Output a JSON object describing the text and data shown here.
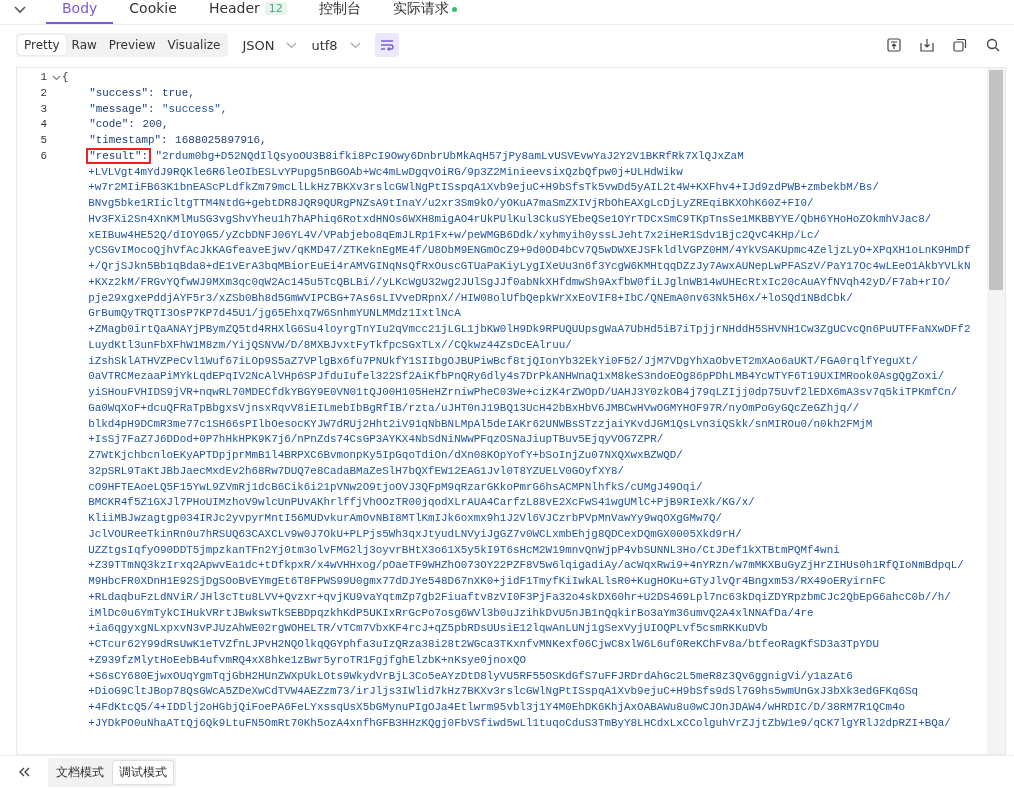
{
  "tabs": [
    {
      "label": "Body",
      "selected": true
    },
    {
      "label": "Cookie",
      "selected": false
    },
    {
      "label": "Header",
      "badge": "12",
      "selected": false
    },
    {
      "label": "控制台",
      "selected": false
    },
    {
      "label": "实际请求",
      "dot": true,
      "selected": false
    }
  ],
  "view_modes": [
    {
      "label": "Pretty",
      "selected": true
    },
    {
      "label": "Raw",
      "selected": false
    },
    {
      "label": "Preview",
      "selected": false
    },
    {
      "label": "Visualize",
      "selected": false
    }
  ],
  "format": "JSON",
  "encoding": "utf8",
  "wrap_on": true,
  "code_lines": [
    {
      "number": "1",
      "text": "{",
      "foldable": true
    },
    {
      "number": "2",
      "key": "\"success\":",
      "highlighted": false,
      "value": "true,",
      "kind": "literal"
    },
    {
      "number": "3",
      "key": "\"message\":",
      "highlighted": false,
      "value": "\"success\",",
      "kind": "string"
    },
    {
      "number": "4",
      "key": "\"code\":",
      "highlighted": false,
      "value": "200,",
      "kind": "literal"
    },
    {
      "number": "5",
      "key": "\"timestamp\":",
      "highlighted": false,
      "value": "1688025897916,",
      "kind": "literal"
    },
    {
      "number": "6",
      "key": "\"result\":",
      "highlighted": true,
      "kind": "string",
      "value_lines": [
        "\"2rdum0bg+D52NQdIlQsyoOU3B8ifki8PcI9Owy6DnbrUbMkAqH57jPy8amLvUSVEvwYaJ2Y2V1BKRfRk7XlQJxZaM",
        "+LVLVgt4mYdJ9RQKle6R6leOIbESLvYPupg5nBGOAb+Wc4mLwDgqvOiRG/9p3Z2MinieevsixQzbQfpw0j+ULHdWikw",
        "+w7r2MIiFB63K1bnEAScPLdfkZm79mcLlLkHz7BKXv3rslcGWlNgPtISspqA1Xvb9ejuC+H9bSfsTk5vwDd5yAIL2t4W+KXFhv4+IJd9zdPWB+zmbekbM/Bs/",
        "BNvg5bke1RIicltgTTM4NtdG+gebtDR8JQR9QURgPNZsA9tInaY/u2xr3Sm9kO/yOKuA7maSmZXIVjRbOhEAXgLcDjLyZREqiBKXOhK60Z+FI0/",
        "Hv3FXi2Sn4XnKMlMuSG3vgShvYheu1h7hAPhiq6RotxdHNOs6WXH8migAO4rUkPUlKul3CkuSYEbeQSe1OYrTDCxSmC9TKpTnsSe1MKBBYYE/QbH6YHoHoZOkmhVJac8/",
        "xEIBuw4HE52Q/dIOY0G5/yZcbDNFJ06YL4V/VPabjebo8qEmJLRp1Fx+w/peWMGB6Ddk/xyhmyih0yssLJeht7x2iHeR1Sdv1Bjc2QvC4KHp/Lc/",
        "yCSGvIMocoQjhVfAcJkKAGfeaveEjwv/qKMD47/ZTKeknEgME4f/U8ObM9ENGmOcZ9+9d0OD4bCv7Q5wDWXEJSFkldlVGPZ0HM/4YkVSAKUpmc4ZeljzLyO+XPqXH1oLnK9HmDf",
        "+/QrjSJkn5Bb1qBda8+dE1vErA3bqMBiorEuEi4rAMVGINqNsQfRxOuscGTUaPaKiyLygIXeUu3n6f3YcgW6KMHtqqDZzJy7AwxAUNepLwPFASzV/PaY17Oc4wLEeO1AkbYVLkN",
        "+KXz2kM/FRGvYQfwWJ9MXm3qc0qW2Ac145u5TcQBLBi//yLKcWgU32wg2JUlSgJJf0abNkXHfdmwSh9AxfbW0fiLJglnWB14wUHEcRtxIc20cAuAYfNVqh42yD/F7ab+rIO/",
        "pje29xgxePddjAYF5r3/xZSb0Bh8d5GmWVIPCBG+7As6sLIVveDRpnX//HIW08olUfbQepkWrXxEoVIF8+IbC/QNEmA0nv63Nk5H6x/+loSQd1NBdCbk/",
        "GrBumQyTRQTI3OsP7KP7d45U1/jg65Ehxq7W6SnhmYUNLMMdz1IxtlNcA",
        "+ZMagb0irtQaANAYjPBymZQ5td4RHXlG6Su4loyrgTnYIu2qVmcc21jLGL1jbKW0lH9Dk9RPUQUUpsgWaA7UbHd5iB7iTpjjrNHddH5SHVNH1Cw3ZgUCvcQn6PuUTFFaNXwDFf2",
        "LuydKtl3unFbXFhW1M8zm/YijQSNVW/D/8MXBJvxtFyTkfpcSGxTLx//CQkwz44ZsDcEAlruu/",
        "iZshSklATHVZPeCvl1Wuf67iLOp9S5aZ7VPlgBx6fu7PNUkfY1SIIbgOJBUPiwBcf8tjQIonYb32EkYi0F52/JjM7VDgYhXaObvET2mXAo6aUKT/FGA0rqlfYeguXt/",
        "0aVTRCMezaaPiMYkLqdEPqIV2NcAlVHp6SPJfduIufel322Sf2AiKfbPnQRy6dly4s7DrPkANHWnaQ1xM8keS3ndoEOg86pPDhLMB4YcWTYF6T19UXIMRook0AsgQgZoxi/",
        "yiSHouFVHIDS9jVR+nqwRL70MDECfdkYBGY9E0VN01tQJ00H105HeHZrniwPheC03We+cizK4rZWOpD/UAHJ3Y0zkOB4j79qLZIjj0dp75Uvf2lEDX6mA3sv7q5kiTPKmfCn/",
        "Ga0WqXoF+dcuQFRaTpBbgxsVjnsxRqvV8iEILmebIbBgRfIB/rzta/uJHT0nJ19BQ13UcH42bBxHbV6JMBCwHVwOGMYHOF97R/nyOmPoGyGQcZeGZhjq//",
        "blkd4pH9DCmR3me77c1SH66sPIlbOesocKYJW7dRUj2Hht2iV91qNbBNLMpAl5deIAKr62UNWBsSTzzjaiYKvdJGM1QsLvn3iQSkk/snMIROu0/n0kh2FMjM",
        "+IsSj7FaZ7J6DDod+0P7hHkHPK9K7j6/nPnZds74CsGP3AYKX4NbSdNiNWwPFqzOSNaJiupTBuv5EjqyVOG7ZPR/",
        "Z7WtKjchbcnloEKyAPTDpjprMmB1l4BRPXC6BvmonpKy5IpGqoTdiOn/dXn08KOpYofY+bSoInjZu07NXQXwxBZWQD/",
        "32pSRL9TaKtJBbJaecMxdEv2h68Rw7DUQ7e8CadaBMaZeSlH7bQXfEW12EAG1Jvl0T8YZUELV0GOyfXY8/",
        "cO9HFTEAoeLQ5F15YwL9ZVmRj1dcB6Cik6i21pVNw2O9tjoOVJ3QFpM9qRzarGKkoPmrG6hsACMPNlhfkS/cUMgJ49Oqi/",
        "BMCKR4f5Z1GXJl7PHoUIMzhoV9wlcUnPUvAKhrlffjVhOOzTR00jqodXLrAUA4CarfzL88vE2XcFwS41wgUMlC+PjB9RIeXk/KG/x/",
        "KliiMBJwzagtgp034IRJc2yvpyrMntI56MUDvkurAmOvNBI8MTlKmIJk6oxmx9h1J2Vl6VJCzrbPVpMnVawYy9wqOXgGMw7Q/",
        "JclVOUReeTkinRn0u7hRSUQ63CAXCLv9w0J7OkU+PLPjs5Wh3qxJtyudLNVyiJgGZ7v0WCLxmbEhjg8QDCexDQmGX0005Xkd9rH/",
        "UZZtgsIqfyO90DDT5jmpzkanTFn2Yj0tm3olvFMG2lj3oyvrBHtX3o61X5y5kI9T6sHcM2W19mnvQnWjpP4vbSUNNL3Ho/CtJDef1kXTBtmPQMf4wni",
        "+Z39TTmNQ3kzIrxq2ApwvEa1dc+tDfkpxR/x4wVHHxog/pOaeTF9WHZhO073OY22PZF8V5w6lqigadiAy/acWqxRwi9+4nYRzn/w7mMKXBuGyZjHrZIHUs0h1RfQIoNmBdpqL/",
        "M9HbcFR0XDnH1E92SjDgSOoBvEYmgEt6T8FPWS99U0gmx77dDJYe548D67nXK0+jidF1TmyfKiIwkALlsR0+KugHOKu+GTyJlvQr4Bngxm53/RX49oERyirnFC",
        "+RLdaqbuFzLdNViR/JHl3cTtu8LVV+Qvzxr+qvjKU9vaYqtmZp7gb2Fiuaftv8zVI0F3PjFa32o4skDX60hr+U2DS469Lpl7nc63kDqiZDYRpzbmCJc2QbEpG6ahcC0b//h/",
        "iMlDc0u6YmTykCIHukVRrtJBwkswTkSEBDpqzkhKdP5UKIxRrGcPo7osg6WVl3b0uJzihkDvU5nJB1nQqkirBo3aYm36umvQ2A4xlNNAfDa/4re",
        "+ia6qgyxgNLxpxvN3vPJUzAhWE02rgWOHELTR/vTCm7VbxKF4rcJ+qZ5pbRDsUUsiE12lqwAnLUNj1gSexVyjUIOQPLvf5csmRKKuDVb",
        "+CTcur62Y99dRsUwK1eTVZfnLJPvH2NQOlkqQGYphfa3uIzQRza38i28t2WGca3TKxnfvMNKexf06CjwC8xlW6L6uf0ReKChFv8a/btfeoRagKfSD3a3TpYDU",
        "+Z939fzMlytHoEebB4ufvmRQ4xX8hke1zBwr5yroTR1FgjfghElzbK+nKsye0jnoxQO",
        "+S6sCY680EjwxOUqYgmTqjGbH2HUnZWXpUkLOts9WkydVrBjL3Co5eAYzDtD8lyVU5RF55OSKdGfS7uFFJRDrdAhGc2L5meR8z3Qv6ggnigVi/y1azAt6",
        "+DioG9CltJBop78QsGWcA5ZDeXwCdTVW4AEZzm73/irJljs3IWlid7kHz7BKXv3rslcGWlNgPtISspqA1Xvb9ejuC+H9bSfs9dSl7G9hs5wmUnGxJ3bXk3edGFKq6Sq",
        "+4FdKtcQ5/4+IDDlj2oHGbjQiFoePA6FeLYxssqUsX5bGMynuPIgOJa4Etlwrm95vbl3j1Y4M0EhDK6KhjAxOABAWu8u0wCJOnJDAW4/wHRDIC/D/38RM7R1QCm4o",
        "+JYDkPO0uNhaATtQj6Qk9LtuFN5OmRt70Kh5ozA4xnfhGFB3HHzKQgj0FbVSfiwd5wLl1tuqoCduS3TmByY8LHCdxLxCColguhVrZJjtZbW1e9/qCK7lgYRlJ2dpRZI+BQa/"
      ]
    }
  ],
  "bottom_modes": [
    {
      "label": "文档模式",
      "selected": false
    },
    {
      "label": "调试模式",
      "selected": true
    }
  ]
}
